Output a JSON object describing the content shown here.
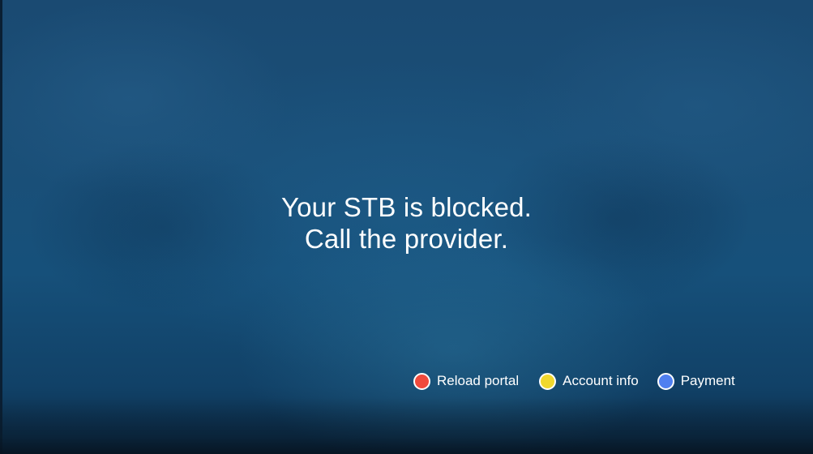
{
  "message": {
    "line1": "Your STB is blocked.",
    "line2": "Call the provider."
  },
  "hints": [
    {
      "label": "Reload portal",
      "color": "#f04a3c",
      "color_name": "red"
    },
    {
      "label": "Account info",
      "color": "#f0d82e",
      "color_name": "yellow"
    },
    {
      "label": "Payment",
      "color": "#4f7ff0",
      "color_name": "blue"
    }
  ],
  "colors": {
    "background": "#1a4f78",
    "text": "#ffffff"
  }
}
